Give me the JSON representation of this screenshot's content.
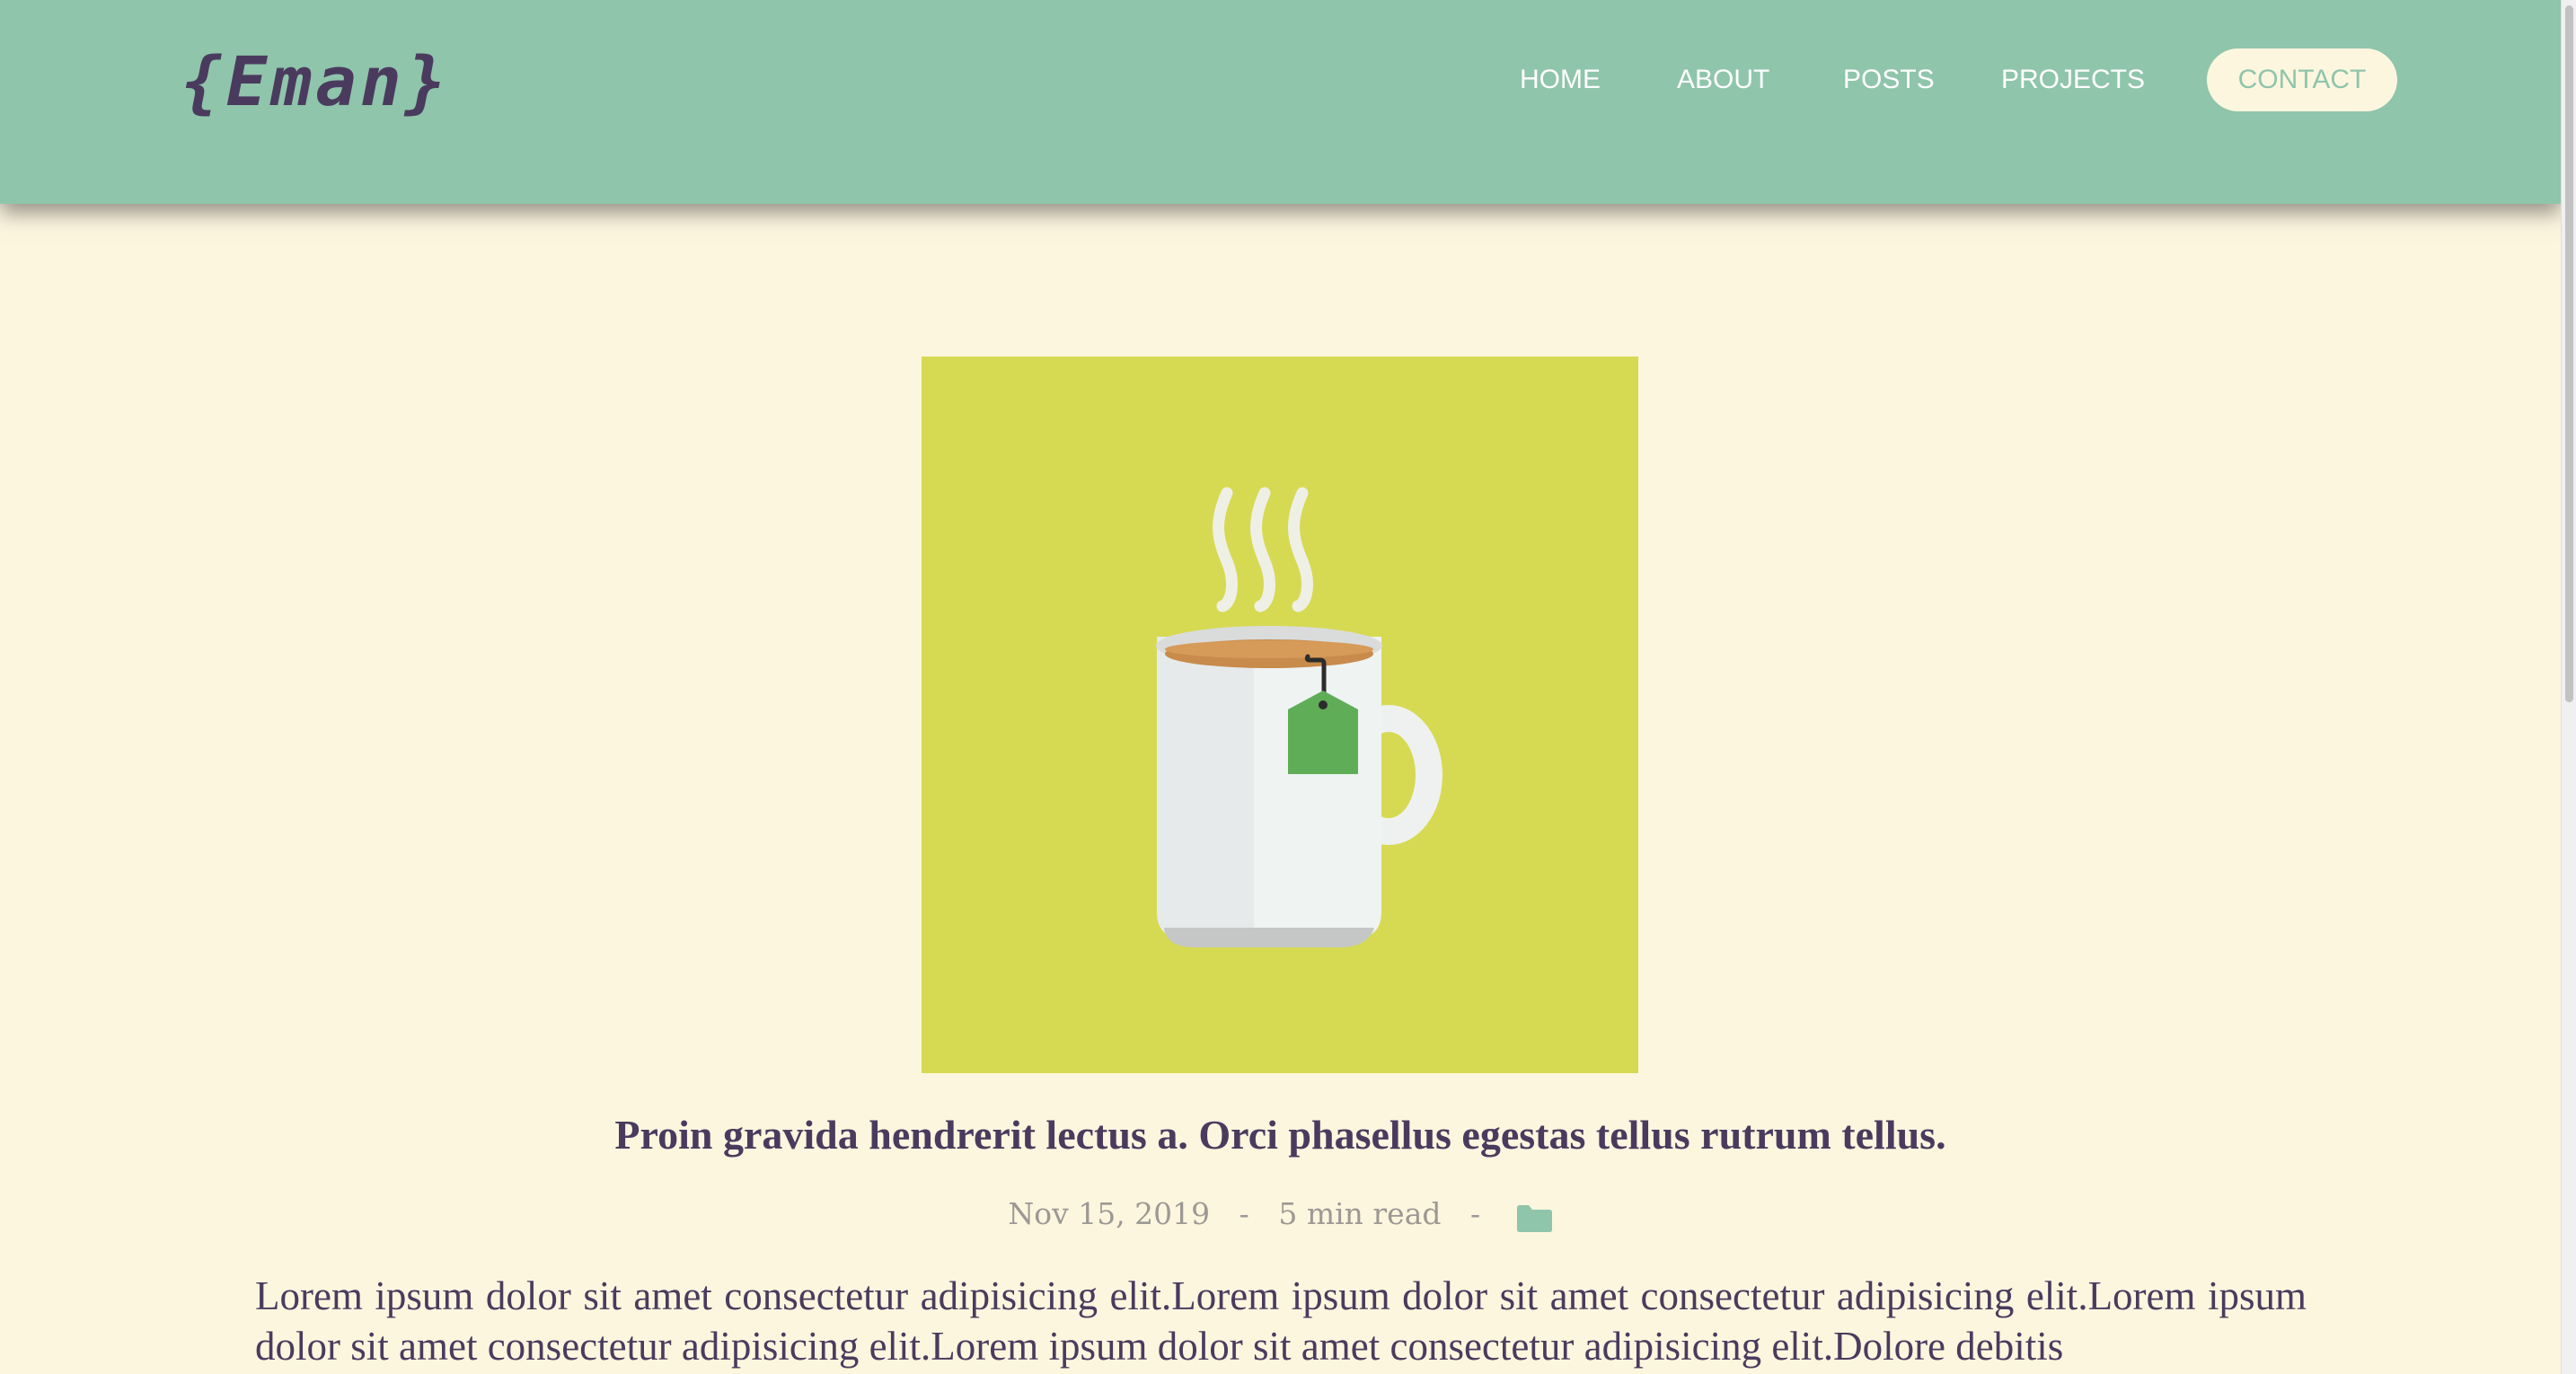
{
  "header": {
    "logo": "{Eman}",
    "nav": {
      "home": "HOME",
      "about": "ABOUT",
      "posts": "POSTS",
      "projects": "PROJECTS",
      "contact": "CONTACT"
    }
  },
  "post": {
    "image_icon": "tea-mug-icon",
    "title": "Proin gravida hendrerit lectus a. Orci phasellus egestas tellus rutrum tellus.",
    "date": "Nov 15, 2019",
    "separator": "-",
    "read_time": "5 min read",
    "category_icon": "folder-icon",
    "body": "Lorem ipsum dolor sit amet consectetur adipisicing elit.Lorem ipsum dolor sit amet consectetur adipisicing elit.Lorem ipsum dolor sit amet consectetur adipisicing elit.Lorem ipsum dolor sit amet consectetur adipisicing elit.Dolore debitis"
  },
  "colors": {
    "header_bg": "#8fc5ab",
    "page_bg": "#fdf6df",
    "text": "#4a3b5e",
    "hero_bg": "#d6da52",
    "meta": "#9c9894"
  }
}
